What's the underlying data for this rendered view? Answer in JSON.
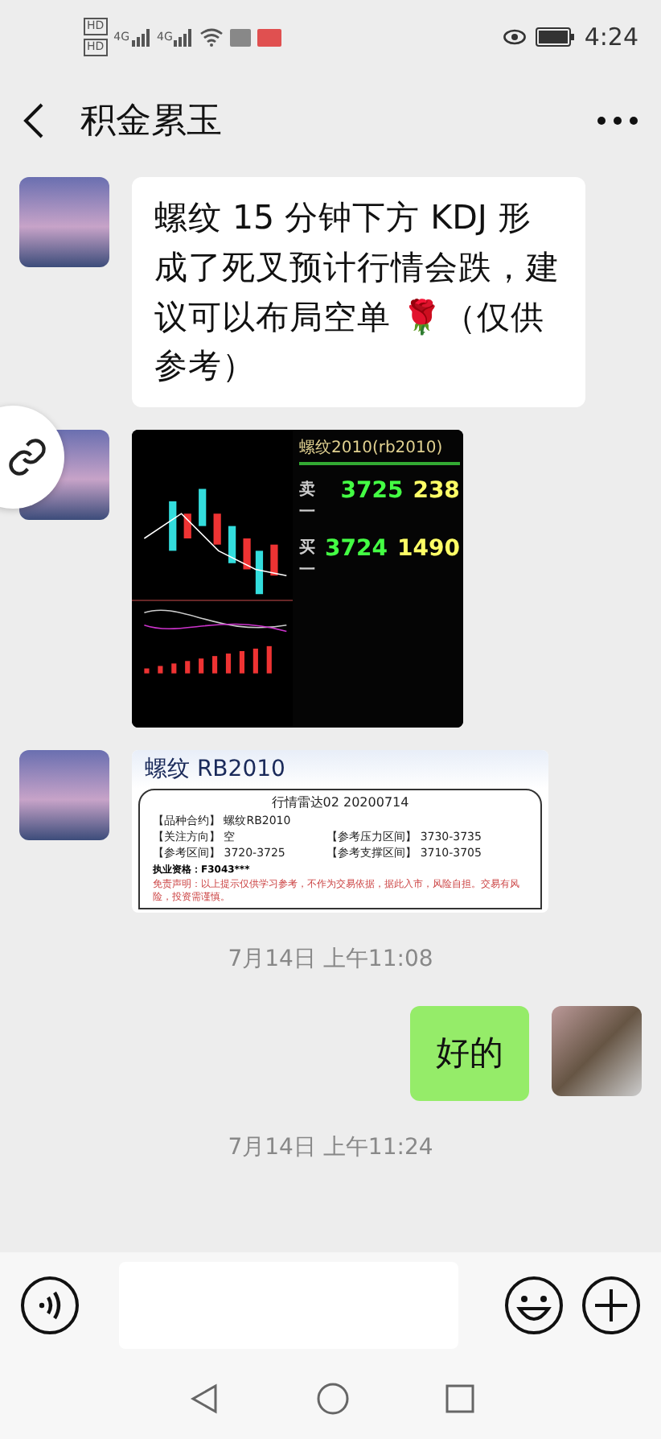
{
  "status_bar": {
    "left_badges": [
      "HD",
      "HD"
    ],
    "network": [
      "4G",
      "4G"
    ],
    "time": "4:24"
  },
  "header": {
    "title": "积金累玉"
  },
  "messages": [
    {
      "kind": "text",
      "outgoing": false,
      "text": "螺纹 15 分钟下方 KDJ 形成了死叉预计行情会跌，建议可以布局空单 🌹（仅供参考）"
    },
    {
      "kind": "quote_screenshot",
      "outgoing": false,
      "title": "螺纹2010(rb2010)",
      "rows": [
        {
          "label": "卖一",
          "price": "3725",
          "volume": "238"
        },
        {
          "label": "买一",
          "price": "3724",
          "volume": "1490"
        }
      ]
    },
    {
      "kind": "document",
      "outgoing": false,
      "title": "螺纹 RB2010",
      "heading": "行情雷达02  20200714",
      "fields": [
        {
          "label": "【品种合约】",
          "value": "螺纹RB2010"
        },
        {
          "label": "【关注方向】",
          "value": "空"
        },
        {
          "label": "【参考压力区间】",
          "value": "3730-3735"
        },
        {
          "label": "【参考区间】",
          "value": "3720-3725"
        },
        {
          "label": "【参考支撑区间】",
          "value": "3710-3705"
        }
      ],
      "license": "执业资格：F3043***",
      "disclaimer": "免责声明：以上提示仅供学习参考，不作为交易依据，据此入市，风险自担。交易有风险，投资需谨慎。"
    },
    {
      "kind": "time",
      "text": "7月14日 上午11:08"
    },
    {
      "kind": "text",
      "outgoing": true,
      "text": "好的"
    },
    {
      "kind": "time",
      "text": "7月14日 上午11:24"
    }
  ]
}
